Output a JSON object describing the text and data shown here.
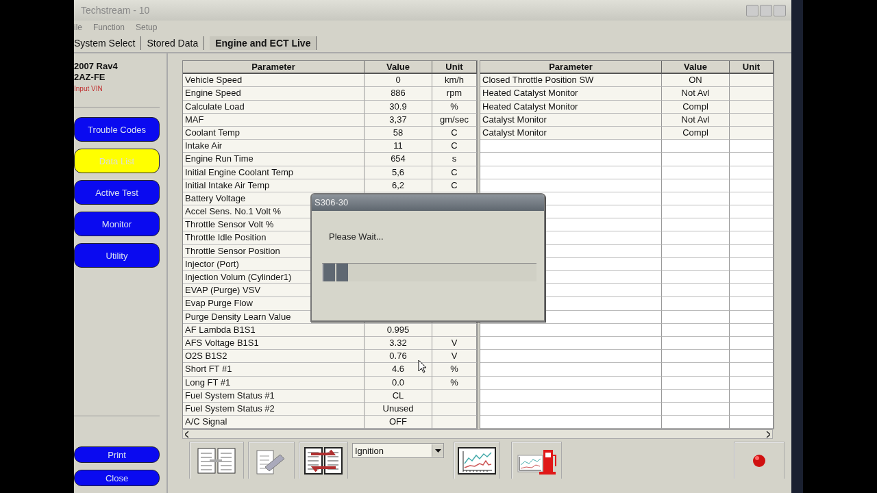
{
  "window": {
    "title": "Techstream - 10"
  },
  "menu": [
    "ile",
    "Function",
    "Setup"
  ],
  "tabs": [
    {
      "label": "System Select",
      "selected": false
    },
    {
      "label": "Stored Data",
      "selected": false
    },
    {
      "label": "Engine and ECT Live",
      "selected": true
    }
  ],
  "vehicle": {
    "model": "2007 Rav4",
    "engine": "2AZ-FE",
    "vin_link": "Input VIN"
  },
  "sidebar": {
    "items": [
      {
        "label": "Trouble Codes",
        "selected": false
      },
      {
        "label": "Data List",
        "selected": true
      },
      {
        "label": "Active Test",
        "selected": false
      },
      {
        "label": "Monitor",
        "selected": false
      },
      {
        "label": "Utility",
        "selected": false
      }
    ],
    "bottom_buttons": [
      "Print",
      "Close"
    ]
  },
  "left_table": {
    "columns": [
      "Parameter",
      "Value",
      "Unit"
    ],
    "rows": [
      {
        "parameter": "Vehicle Speed",
        "value": "0",
        "unit": "km/h"
      },
      {
        "parameter": "Engine Speed",
        "value": "886",
        "unit": "rpm"
      },
      {
        "parameter": "Calculate Load",
        "value": "30.9",
        "unit": "%"
      },
      {
        "parameter": "MAF",
        "value": "3,37",
        "unit": "gm/sec"
      },
      {
        "parameter": "Coolant Temp",
        "value": "58",
        "unit": "C"
      },
      {
        "parameter": "Intake Air",
        "value": "11",
        "unit": "C"
      },
      {
        "parameter": "Engine Run Time",
        "value": "654",
        "unit": "s"
      },
      {
        "parameter": "Initial Engine Coolant Temp",
        "value": "5,6",
        "unit": "C"
      },
      {
        "parameter": "Initial Intake Air Temp",
        "value": "6,2",
        "unit": "C"
      },
      {
        "parameter": "Battery Voltage"
      },
      {
        "parameter": "Accel Sens. No.1 Volt %"
      },
      {
        "parameter": "Throttle Sensor Volt %"
      },
      {
        "parameter": "Throttle Idle Position"
      },
      {
        "parameter": "Throttle Sensor Position"
      },
      {
        "parameter": "Injector (Port)"
      },
      {
        "parameter": "Injection Volum (Cylinder1)"
      },
      {
        "parameter": "EVAP (Purge) VSV"
      },
      {
        "parameter": "Evap Purge Flow"
      },
      {
        "parameter": "Purge Density Learn Value"
      },
      {
        "parameter": "AF Lambda B1S1",
        "value": "0.995"
      },
      {
        "parameter": "AFS Voltage B1S1",
        "value": "3.32",
        "unit": "V"
      },
      {
        "parameter": "O2S B1S2",
        "value": "0.76",
        "unit": "V"
      },
      {
        "parameter": "Short FT #1",
        "value": "4.6",
        "unit": "%"
      },
      {
        "parameter": "Long FT #1",
        "value": "0.0",
        "unit": "%"
      },
      {
        "parameter": "Fuel System Status #1",
        "value": "CL"
      },
      {
        "parameter": "Fuel System Status #2",
        "value": "Unused"
      },
      {
        "parameter": "A/C Signal",
        "value": "OFF"
      }
    ]
  },
  "right_table": {
    "columns": [
      "Parameter",
      "Value",
      "Unit"
    ],
    "rows": [
      {
        "parameter": "Closed Throttle Position SW",
        "value": "ON"
      },
      {
        "parameter": "Heated Catalyst Monitor",
        "value": "Not Avl"
      },
      {
        "parameter": "Heated Catalyst Monitor",
        "value": "Compl"
      },
      {
        "parameter": "Catalyst Monitor",
        "value": "Not Avl"
      },
      {
        "parameter": "Catalyst Monitor",
        "value": "Compl"
      }
    ]
  },
  "dialog": {
    "title": "S306-30",
    "message": "Please Wait...",
    "progress": {
      "level": 0.12
    }
  },
  "toolbar": {
    "dropdown": {
      "value": "Ignition"
    }
  }
}
